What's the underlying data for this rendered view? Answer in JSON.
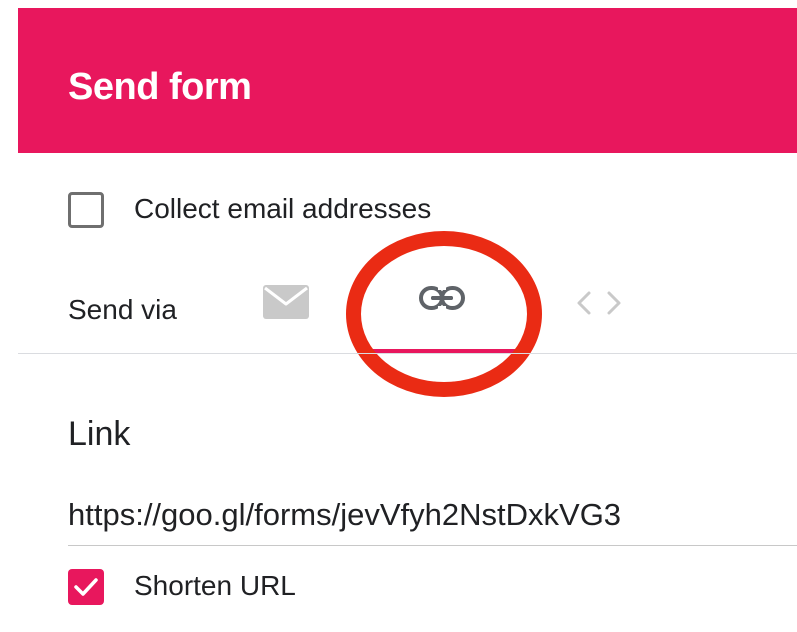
{
  "header": {
    "title": "Send form",
    "color": "#e8175d"
  },
  "options": {
    "collect_email_label": "Collect email addresses",
    "collect_email_checked": false
  },
  "send_via": {
    "label": "Send via",
    "tabs": [
      {
        "icon": "email-icon",
        "selected": false
      },
      {
        "icon": "link-icon",
        "selected": true
      },
      {
        "icon": "embed-code-icon",
        "selected": false
      }
    ]
  },
  "link_section": {
    "heading": "Link",
    "url": "https://goo.gl/forms/jevVfyh2NstDxkVG3",
    "shorten_label": "Shorten URL",
    "shorten_checked": true
  },
  "annotation": {
    "shape": "red-circle-highlight",
    "color": "#ea2b14"
  }
}
